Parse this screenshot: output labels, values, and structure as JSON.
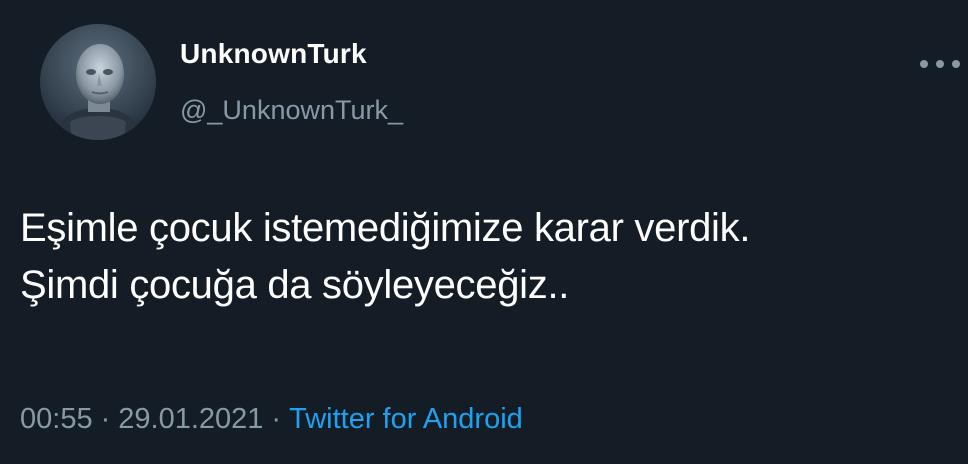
{
  "user": {
    "display_name": "UnknownTurk",
    "handle": "@_UnknownTurk_",
    "avatar_icon": "profile-avatar"
  },
  "tweet": {
    "lines": [
      "Eşimle çocuk istemediğimize karar verdik.",
      "Şimdi çocuğa da söyleyeceğiz.."
    ]
  },
  "meta": {
    "time": "00:55",
    "separator": "·",
    "date": "29.01.2021",
    "source": "Twitter for Android"
  },
  "menu": {
    "icon": "more-horizontal-icon"
  },
  "colors": {
    "background": "#141d26",
    "text": "#ffffff",
    "secondary_text": "#8899a6",
    "link": "#1da1f2"
  }
}
